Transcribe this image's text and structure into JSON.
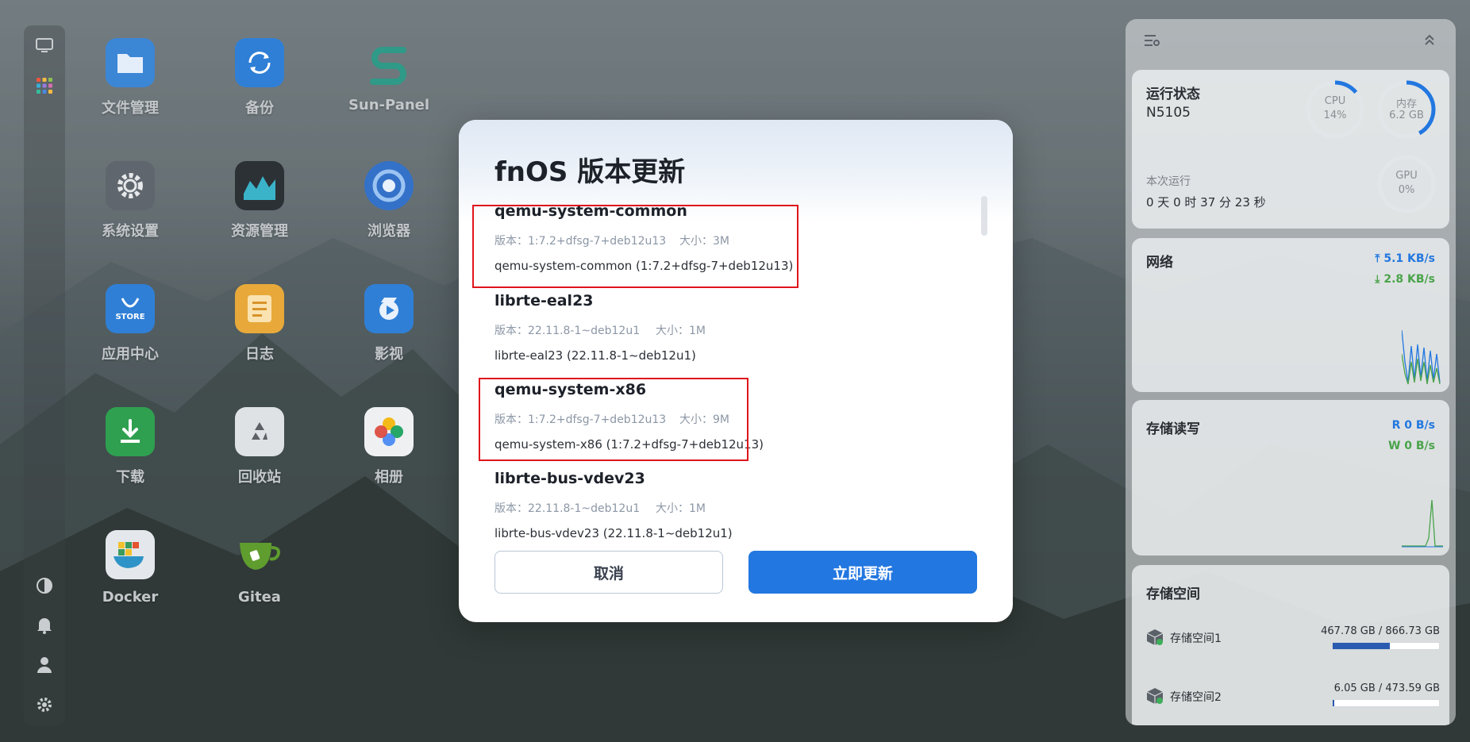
{
  "desktop": {
    "apps": [
      {
        "label": "文件管理",
        "icon": "folder-icon"
      },
      {
        "label": "备份",
        "icon": "backup-sync-icon"
      },
      {
        "label": "Sun-Panel",
        "icon": "sun-panel-logo-icon"
      },
      {
        "label": "系统设置",
        "icon": "gear-icon"
      },
      {
        "label": "资源管理",
        "icon": "resource-monitor-icon"
      },
      {
        "label": "浏览器",
        "icon": "browser-icon"
      },
      {
        "label": "应用中心",
        "icon": "store-bag-icon"
      },
      {
        "label": "日志",
        "icon": "log-notes-icon"
      },
      {
        "label": "影视",
        "icon": "video-play-icon"
      },
      {
        "label": "下载",
        "icon": "download-icon"
      },
      {
        "label": "回收站",
        "icon": "recycle-bin-icon"
      },
      {
        "label": "相册",
        "icon": "photos-flower-icon"
      },
      {
        "label": "Docker",
        "icon": "docker-whale-icon"
      },
      {
        "label": "Gitea",
        "icon": "gitea-teacup-icon"
      }
    ],
    "store_badge": "STORE"
  },
  "dock": {
    "items": [
      "monitor-icon",
      "app-grid-icon",
      "theme-icon",
      "bell-icon",
      "user-icon",
      "settings-icon"
    ]
  },
  "widgets": {
    "status": {
      "title": "运行状态",
      "device": "N5105",
      "cpu_label": "CPU",
      "cpu_value": "14%",
      "cpu_fraction": 0.14,
      "mem_label": "内存",
      "mem_value": "6.2 GB",
      "mem_fraction": 0.42,
      "gpu_label": "GPU",
      "gpu_value": "0%",
      "uptime_label": "本次运行",
      "uptime_value": "0 天 0 时 37 分 23 秒"
    },
    "network": {
      "title": "网络",
      "up": "5.1 KB/s",
      "down": "2.8 KB/s"
    },
    "disk_io": {
      "title": "存储读写",
      "read_label": "R",
      "read": "0 B/s",
      "write_label": "W",
      "write": "0 B/s"
    },
    "storage": {
      "title": "存储空间",
      "volumes": [
        {
          "name": "存储空间1",
          "usage": "467.78 GB / 866.73 GB",
          "fraction": 0.54
        },
        {
          "name": "存储空间2",
          "usage": "6.05 GB / 473.59 GB",
          "fraction": 0.013
        }
      ]
    }
  },
  "dialog": {
    "title": "fnOS 版本更新",
    "version_prefix": "版本：",
    "size_prefix": "大小：",
    "packages": [
      {
        "name": "qemu-system-common",
        "version": "版本：1:7.2+dfsg-7+deb12u13",
        "size": "大小：3M",
        "desc": "qemu-system-common (1:7.2+dfsg-7+deb12u13)"
      },
      {
        "name": "librte-eal23",
        "version": "版本：22.11.8-1~deb12u1",
        "size": "大小：1M",
        "desc": "librte-eal23 (22.11.8-1~deb12u1)"
      },
      {
        "name": "qemu-system-x86",
        "version": "版本：1:7.2+dfsg-7+deb12u13",
        "size": "大小：9M",
        "desc": "qemu-system-x86 (1:7.2+dfsg-7+deb12u13)"
      },
      {
        "name": "librte-bus-vdev23",
        "version": "版本：22.11.8-1~deb12u1",
        "size": "大小：1M",
        "desc": "librte-bus-vdev23 (22.11.8-1~deb12u1)"
      }
    ],
    "cancel_label": "取消",
    "update_label": "立即更新"
  },
  "colors": {
    "accent": "#2277e0",
    "highlight_box": "#e0151c",
    "net_up": "#2277e0",
    "net_down": "#4aa34a"
  }
}
